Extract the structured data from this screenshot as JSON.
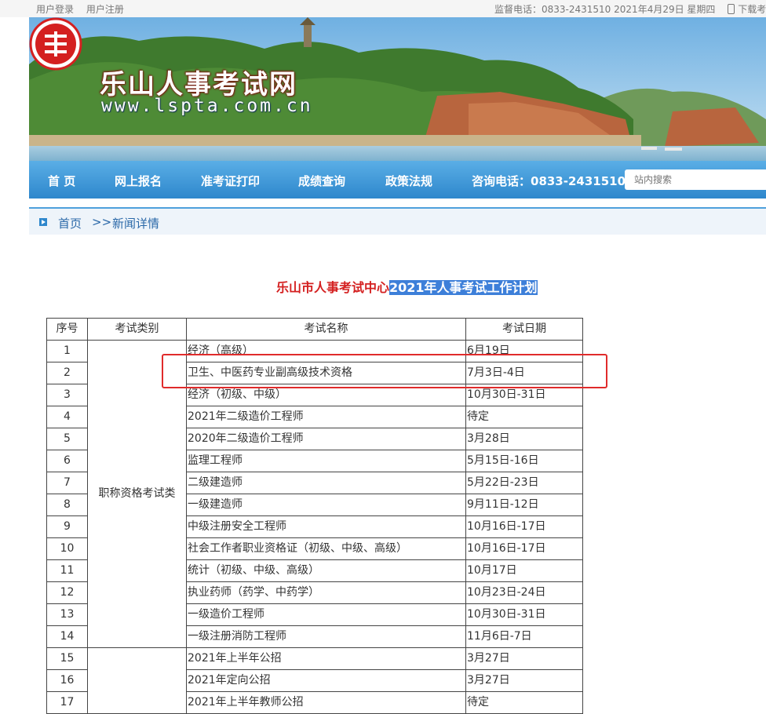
{
  "topbar": {
    "login": "用户登录",
    "register": "用户注册",
    "supervision_phone": "监督电话：0833-2431510",
    "date": "2021年4月29日 星期四",
    "download": "下载考生"
  },
  "site": {
    "name": "乐山人事考试网",
    "url": "www.lspta.com.cn"
  },
  "nav": {
    "items": [
      "首 页",
      "网上报名",
      "准考证打印",
      "成绩查询",
      "政策法规"
    ],
    "hotline": "咨询电话：0833-2431510",
    "search_placeholder": "站内搜索"
  },
  "breadcrumb": {
    "home": "首页",
    "separator": ">>",
    "current": "新闻详情"
  },
  "article": {
    "title_org": "乐山市人事考试中心",
    "title_main": "2021年人事考试工作计划"
  },
  "table": {
    "headers": [
      "序号",
      "考试类别",
      "考试名称",
      "考试日期"
    ],
    "category_1": "职称资格考试类",
    "rows": [
      {
        "seq": "1",
        "name": "经济（高级）",
        "date": "6月19日"
      },
      {
        "seq": "2",
        "name": "卫生、中医药专业副高级技术资格",
        "date": "7月3日-4日"
      },
      {
        "seq": "3",
        "name": "经济（初级、中级）",
        "date": "10月30日-31日"
      },
      {
        "seq": "4",
        "name": "2021年二级造价工程师",
        "date": "待定"
      },
      {
        "seq": "5",
        "name": "2020年二级造价工程师",
        "date": "3月28日"
      },
      {
        "seq": "6",
        "name": "监理工程师",
        "date": "5月15日-16日"
      },
      {
        "seq": "7",
        "name": "二级建造师",
        "date": "5月22日-23日"
      },
      {
        "seq": "8",
        "name": "一级建造师",
        "date": "9月11日-12日"
      },
      {
        "seq": "9",
        "name": "中级注册安全工程师",
        "date": "10月16日-17日"
      },
      {
        "seq": "10",
        "name": "社会工作者职业资格证（初级、中级、高级）",
        "date": "10月16日-17日"
      },
      {
        "seq": "11",
        "name": "统计（初级、中级、高级）",
        "date": "10月17日"
      },
      {
        "seq": "12",
        "name": "执业药师（药学、中药学）",
        "date": "10月23日-24日"
      },
      {
        "seq": "13",
        "name": "一级造价工程师",
        "date": "10月30日-31日"
      },
      {
        "seq": "14",
        "name": "一级注册消防工程师",
        "date": "11月6日-7日"
      },
      {
        "seq": "15",
        "name": "2021年上半年公招",
        "date": "3月27日"
      },
      {
        "seq": "16",
        "name": "2021年定向公招",
        "date": "3月27日"
      },
      {
        "seq": "17",
        "name": "2021年上半年教师公招",
        "date": "待定"
      }
    ]
  },
  "colors": {
    "nav_blue": "#2e87cc",
    "title_red": "#d42020",
    "selection_blue": "#3d7fd9",
    "highlight_red": "#e02b2b"
  }
}
